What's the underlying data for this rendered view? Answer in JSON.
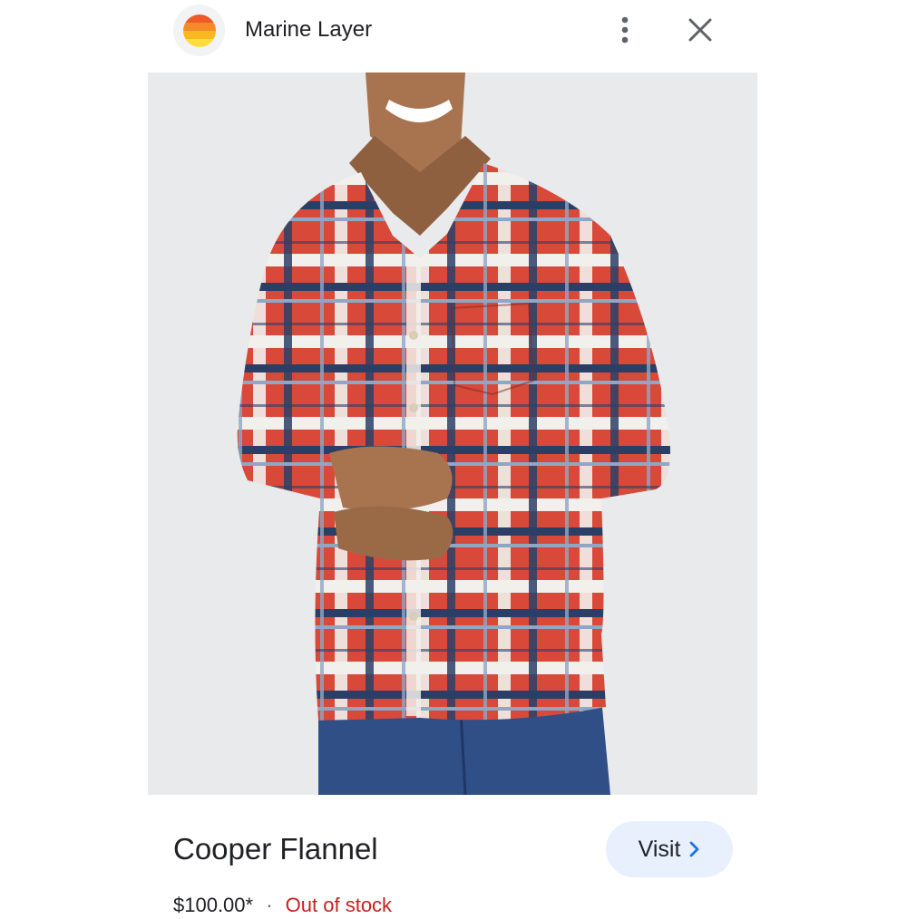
{
  "header": {
    "site_name": "Marine Layer",
    "logo_stripes": [
      "#ef5a29",
      "#f58a2a",
      "#f8b81f",
      "#fbdd3b"
    ],
    "logo_icon": "marine-layer-sunset-logo",
    "menu_icon": "more-vert-icon",
    "close_icon": "close-icon"
  },
  "product": {
    "image_icon": "product-photo-plaid-flannel-shirt",
    "title": "Cooper Flannel",
    "price": "$100.00*",
    "separator": "·",
    "stock_status": "Out of stock"
  },
  "actions": {
    "visit_label": "Visit",
    "visit_icon": "chevron-right-icon"
  },
  "colors": {
    "accent_button_bg": "#e8f0fe",
    "chevron": "#1a73e8",
    "stock_red": "#c5221f"
  }
}
